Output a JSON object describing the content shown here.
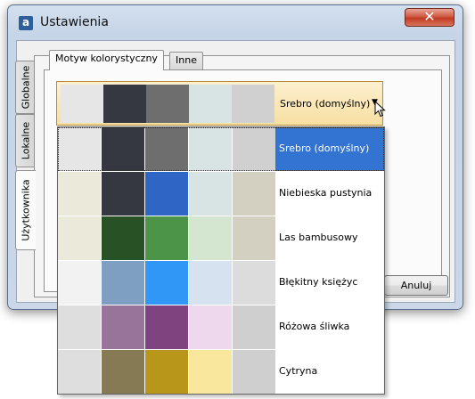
{
  "window": {
    "title": "Ustawienia",
    "app_icon_letter": "a",
    "close_symbol": "✕"
  },
  "side_tabs": [
    {
      "label": "Globalne",
      "active": false
    },
    {
      "label": "Lokalne",
      "active": false
    },
    {
      "label": "Użytkownika",
      "active": true
    }
  ],
  "top_tabs": [
    {
      "label": "Motyw kolorystyczny",
      "active": true
    },
    {
      "label": "Inne",
      "active": false
    }
  ],
  "theme_combo": {
    "selected_label": "Srebro (domyślny)",
    "arrow": "▼",
    "swatches": [
      "#e6e6e6",
      "#353840",
      "#6e6e6e",
      "#d8e4e4",
      "#d0d0d0"
    ]
  },
  "theme_options": [
    {
      "label": "Srebro (domyślny)",
      "selected": true,
      "swatches": [
        "#e6e6e6",
        "#353840",
        "#6e6e6e",
        "#d8e4e4",
        "#d0d0d0"
      ]
    },
    {
      "label": "Niebieska pustynia",
      "selected": false,
      "swatches": [
        "#ebe9da",
        "#353840",
        "#2f66c5",
        "#d8e4e4",
        "#d3cfc1"
      ]
    },
    {
      "label": "Las bambusowy",
      "selected": false,
      "swatches": [
        "#ebe9da",
        "#285225",
        "#4c9548",
        "#d4e6d0",
        "#d3cfc1"
      ]
    },
    {
      "label": "Błękitny księżyc",
      "selected": false,
      "swatches": [
        "#f2f2f2",
        "#7e9fc2",
        "#3197f7",
        "#d6e2ef",
        "#dcdcdc"
      ]
    },
    {
      "label": "Różowa śliwka",
      "selected": false,
      "swatches": [
        "#dedede",
        "#98739a",
        "#7f437f",
        "#eed8ee",
        "#cfcfcf"
      ]
    },
    {
      "label": "Cytryna",
      "selected": false,
      "swatches": [
        "#dedede",
        "#867a55",
        "#b8961a",
        "#fae79e",
        "#cfcfcf"
      ]
    }
  ],
  "buttons": {
    "cancel": "Anuluj"
  },
  "colors": {
    "selection": "#3374d2",
    "combo_hover": "#f7dfa2"
  }
}
